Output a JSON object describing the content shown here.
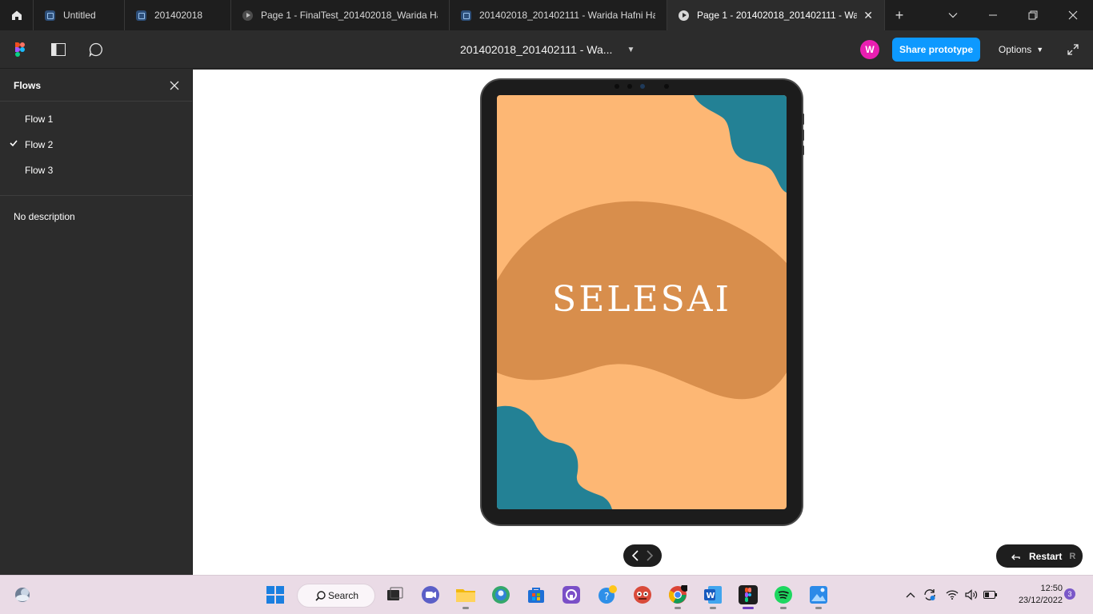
{
  "tabs": [
    {
      "label": "Untitled",
      "kind": "file"
    },
    {
      "label": "201402018",
      "kind": "file"
    },
    {
      "label": "Page 1 - FinalTest_201402018_Warida Haf",
      "kind": "prototype"
    },
    {
      "label": "201402018_201402111 - Warida Hafni Har",
      "kind": "file"
    },
    {
      "label": "Page 1 - 201402018_201402111 - Warid",
      "kind": "prototype",
      "active": true
    }
  ],
  "toolbar": {
    "doc_title": "201402018_201402111 - Wa...",
    "avatar_initial": "W",
    "share_label": "Share prototype",
    "options_label": "Options"
  },
  "panel": {
    "title": "Flows",
    "flows": [
      {
        "label": "Flow 1",
        "selected": false
      },
      {
        "label": "Flow 2",
        "selected": true
      },
      {
        "label": "Flow 3",
        "selected": false
      }
    ],
    "description": "No description"
  },
  "canvas": {
    "screen_text": "SELESAI",
    "restart_label": "Restart",
    "restart_key": "R",
    "colors": {
      "peach": "#fdb774",
      "brown": "#d88e4c",
      "teal": "#238195"
    }
  },
  "taskbar": {
    "search_label": "Search",
    "time": "12:50",
    "date": "23/12/2022",
    "notification_count": "3"
  }
}
